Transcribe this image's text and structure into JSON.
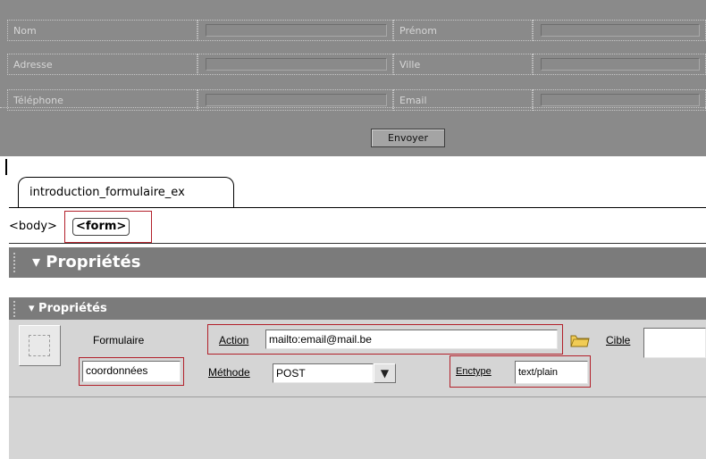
{
  "preview": {
    "rows": [
      {
        "left_label": "Nom",
        "right_label": "Prénom"
      },
      {
        "left_label": "Adresse",
        "right_label": "Ville"
      },
      {
        "left_label": "Téléphone",
        "right_label": "Email"
      }
    ],
    "submit_label": "Envoyer"
  },
  "document_tab": "introduction_formulaire_ex",
  "tag_selector": {
    "body": "<body>",
    "form": "<form>"
  },
  "properties_title": "▾ Propriétés",
  "inspector": {
    "title": "▾ Propriétés",
    "element_type": "Formulaire",
    "form_name": "coordonnées",
    "action_label": "Action",
    "action_value": "mailto:email@mail.be",
    "target_label": "Cible",
    "target_value": "",
    "method_label": "Méthode",
    "method_value": "POST",
    "enctype_label": "Enctype",
    "enctype_value": "text/plain"
  },
  "colors": {
    "highlight": "#b2202a",
    "panel_bar": "#7b7b7b"
  }
}
